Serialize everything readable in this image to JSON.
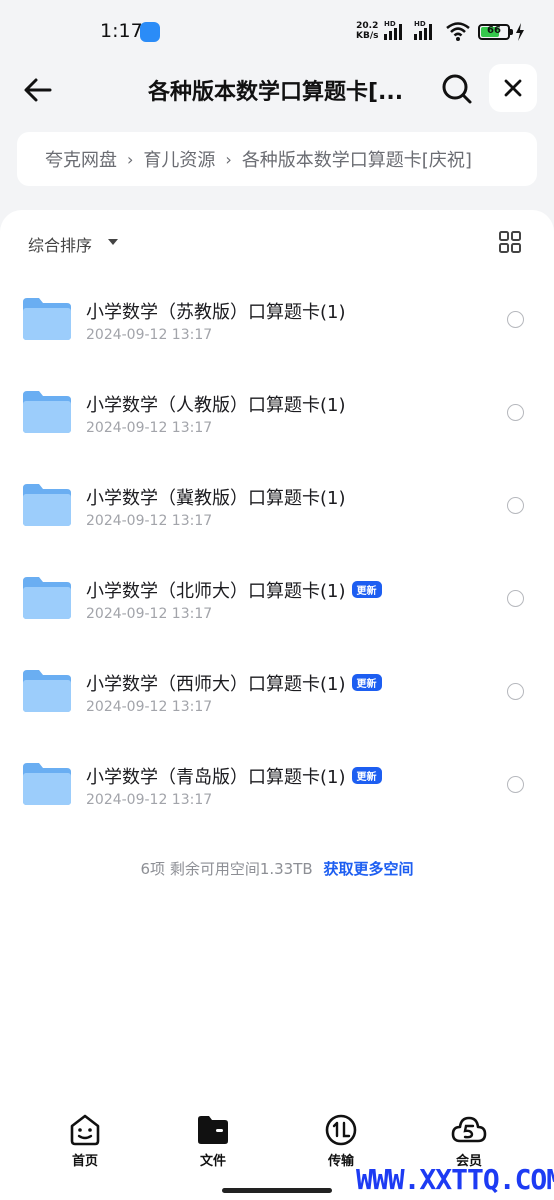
{
  "status_bar": {
    "time": "1:17",
    "speed_value": "20.2",
    "speed_unit": "KB/s",
    "signal_1_label": "HD",
    "signal_2_label": "HD",
    "battery_level": "66"
  },
  "header": {
    "title": "各种版本数学口算题卡[..."
  },
  "breadcrumb": {
    "items": [
      "夸克网盘",
      "育儿资源",
      "各种版本数学口算题卡[庆祝]"
    ]
  },
  "toolbar": {
    "sort_label": "综合排序"
  },
  "files": [
    {
      "name": "小学数学（苏教版）口算题卡(1)",
      "date": "2024-09-12 13:17",
      "badge": ""
    },
    {
      "name": "小学数学（人教版）口算题卡(1)",
      "date": "2024-09-12 13:17",
      "badge": ""
    },
    {
      "name": "小学数学（冀教版）口算题卡(1)",
      "date": "2024-09-12 13:17",
      "badge": ""
    },
    {
      "name": "小学数学（北师大）口算题卡(1)",
      "date": "2024-09-12 13:17",
      "badge": "更新"
    },
    {
      "name": "小学数学（西师大）口算题卡(1)",
      "date": "2024-09-12 13:17",
      "badge": "更新"
    },
    {
      "name": "小学数学（青岛版）口算题卡(1)",
      "date": "2024-09-12 13:17",
      "badge": "更新"
    }
  ],
  "footer": {
    "info": "6项 剩余可用空间1.33TB",
    "link": "获取更多空间"
  },
  "bottom_nav": {
    "items": [
      {
        "label": "首页",
        "icon": "home-face-icon"
      },
      {
        "label": "文件",
        "icon": "folder-icon"
      },
      {
        "label": "传输",
        "icon": "transfer-icon"
      },
      {
        "label": "会员",
        "icon": "membership-cloud-icon"
      }
    ]
  },
  "watermark": "WWW.XXTTQ.COM",
  "colors": {
    "accent": "#1d5ef1",
    "folder": "#7db9f5",
    "background": "#f3f4f6"
  }
}
